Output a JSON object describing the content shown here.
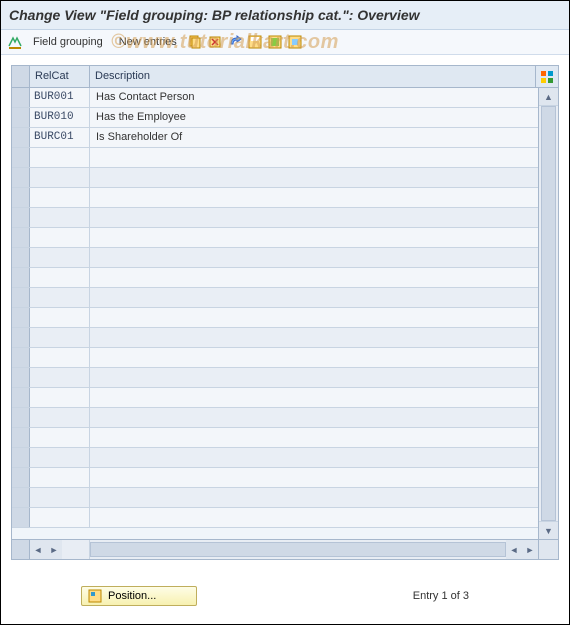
{
  "title": "Change View \"Field grouping: BP relationship cat.\": Overview",
  "toolbar": {
    "field_grouping": "Field grouping",
    "new_entries": "New entries"
  },
  "columns": {
    "relcat": "RelCat",
    "description": "Description"
  },
  "rows": [
    {
      "relcat": "BUR001",
      "desc": "Has Contact Person"
    },
    {
      "relcat": "BUR010",
      "desc": "Has the Employee"
    },
    {
      "relcat": "BURC01",
      "desc": "Is Shareholder Of"
    }
  ],
  "empty_row_count": 19,
  "footer": {
    "position_label": "Position...",
    "entry_text": "Entry 1 of 3"
  },
  "watermark": "©www.tutorialkart.com"
}
